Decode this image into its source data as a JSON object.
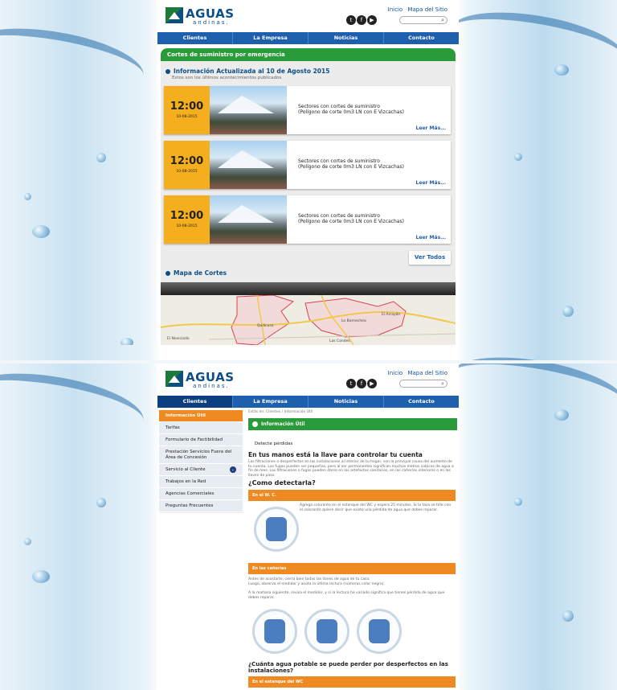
{
  "logo": {
    "name": "AGUAS",
    "tagline": "andinas."
  },
  "toplinks": {
    "home": "Inicio",
    "sitemap": "Mapa del Sitio"
  },
  "search": {
    "placeholder": ""
  },
  "nav": [
    "Clientes",
    "La Empresa",
    "Noticias",
    "Contacto"
  ],
  "emergency": {
    "title": "Cortes de suministro por emergencia",
    "updated": "Información Actualizada al 10 de Agosto 2015",
    "subtitle": "Estos son los últimos acontecimientos publicados",
    "cards": [
      {
        "time": "12:00",
        "date": "10-08-2015",
        "line1": "Sectores con cortes de suministro",
        "line2": "(Polígono de corte  0m3 LN con E Vizcachas)",
        "more": "Leer Más..."
      },
      {
        "time": "12:00",
        "date": "10-08-2015",
        "line1": "Sectores con cortes de suministro",
        "line2": "(Polígono de corte  0m3 LN con E Vizcachas)",
        "more": "Leer Más..."
      },
      {
        "time": "12:00",
        "date": "10-08-2015",
        "line1": "Sectores con cortes de suministro",
        "line2": "(Polígono de corte  0m3 LN con E Vizcachas)",
        "more": "Leer Más..."
      }
    ],
    "view_all": "Ver Todos",
    "map_title": "Mapa de Cortes",
    "map_labels": {
      "a": "Quilicura",
      "b": "El Arrayán",
      "c": "Lo Barnechea",
      "d": "Las Condes",
      "e": "El Noviciado"
    }
  },
  "page2": {
    "sidebar": [
      "Información Útil",
      "Tarifas",
      "Formulario de Factibilidad",
      "Prestación Servicios Fuera del Área de Concesión",
      "Servicio al Cliente",
      "Trabajos en la Red",
      "Agencias Comerciales",
      "Preguntas Frecuentes"
    ],
    "breadcrumb": "Estás en: Clientes / Información Útil",
    "section_title": "Información Útil",
    "detect": "Detecte pérdidas",
    "headline": "En tus manos está la llave para controlar tu cuenta",
    "intro": "Las filtraciones o desperfectos en las instalaciones al interior de tu hogar, son la principal causa del aumento de tu cuenta. Las fugas pueden ser pequeñas, pero al ser permanentes significan muchos metros cúbicos de agua a fin de mes. Las filtraciones o fugas pueden darse en los artefactos sanitarios, en las cañerías interiores o en las llaves de paso.",
    "how_title": "¿Como detectarla?",
    "wc_bar": "En el W. C.",
    "wc_text": "Agrega colorante en el estanque del WC y espera 25 minutos. Si la taza se tiñe con el colorante quiere decir que existe una pérdida de agua que debes reparar.",
    "pipes_bar": "En las cañerías",
    "pipes_text1": "Antes de acostarte, cierra bien todas las llaves de agua de tu casa.",
    "pipes_text2": "Luego, observa el medidor y anota la última lectura (números color negro).",
    "pipes_text3": "A la mañana siguiente, revisa el medidor, y si la lectura ha variado significa que tienes pérdida de agua que debes reparar.",
    "question": "¿Cuánta agua potable se puede perder por desperfectos en las instalaciones?",
    "tank_bar": "En el estanque del WC"
  }
}
